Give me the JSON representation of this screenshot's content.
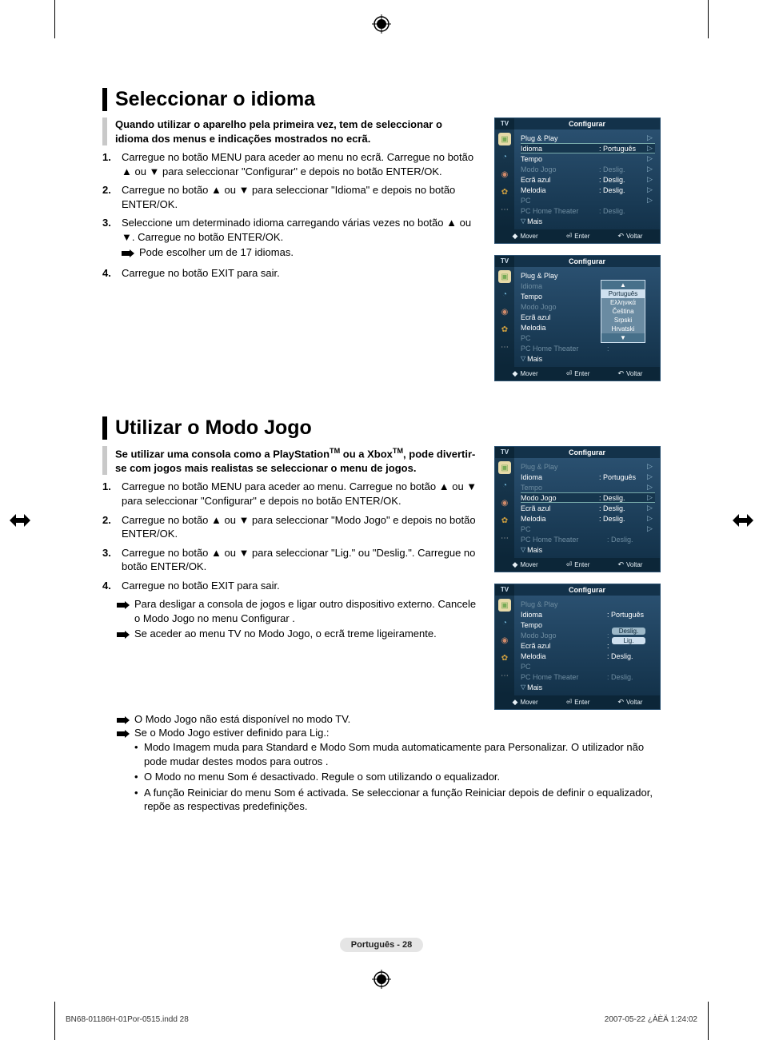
{
  "section1": {
    "title": "Seleccionar o idioma",
    "intro": "Quando utilizar o aparelho pela primeira vez, tem de seleccionar o idioma dos menus e indicações mostrados no ecrã.",
    "steps": [
      {
        "n": "1.",
        "t": "Carregue no botão MENU para aceder ao menu no ecrã. Carregue no botão ▲ ou ▼ para seleccionar \"Configurar\" e depois no botão ENTER/OK."
      },
      {
        "n": "2.",
        "t": "Carregue no botão ▲ ou ▼ para seleccionar \"Idioma\" e depois no botão ENTER/OK."
      },
      {
        "n": "3.",
        "t": "Seleccione um determinado idioma carregando várias vezes no botão ▲ ou ▼. Carregue no botão ENTER/OK."
      },
      {
        "n": "4.",
        "t": "Carregue no botão EXIT para sair."
      }
    ],
    "note_after3": "Pode escolher um de 17 idiomas."
  },
  "section2": {
    "title": "Utilizar o Modo Jogo",
    "intro_pre": "Se utilizar uma consola como a PlayStation",
    "intro_mid": " ou a Xbox",
    "intro_post": ", pode divertir-se com jogos mais realistas se seleccionar o menu de jogos.",
    "tm": "TM",
    "steps": [
      {
        "n": "1.",
        "t": "Carregue no botão MENU para aceder ao menu. Carregue no botão ▲ ou ▼ para seleccionar \"Configurar\" e depois no botão ENTER/OK."
      },
      {
        "n": "2.",
        "t": "Carregue no botão ▲ ou ▼ para seleccionar \"Modo Jogo\" e depois no botão ENTER/OK."
      },
      {
        "n": "3.",
        "t": "Carregue no botão ▲ ou ▼ para seleccionar \"Lig.\" ou \"Deslig.\". Carregue no botão ENTER/OK."
      },
      {
        "n": "4.",
        "t": "Carregue no botão EXIT para sair."
      }
    ],
    "notes": [
      "Para desligar a consola de jogos e ligar outro dispositivo externo. Cancele o Modo Jogo no menu Configurar .",
      "Se aceder ao menu TV no Modo Jogo, o ecrã treme ligeiramente.",
      "O Modo Jogo não está disponível no modo TV.",
      "Se o Modo Jogo estiver definido para Lig.:"
    ],
    "bullets": [
      "Modo Imagem muda para Standard e Modo Som muda automaticamente para Personalizar. O utilizador não pode mudar destes modos para outros .",
      "O Modo no menu Som é desactivado. Regule o som utilizando o equalizador.",
      "A função Reiniciar do menu Som é activada. Se seleccionar a função Reiniciar depois de definir o equalizador, repõe as respectivas predefinições."
    ]
  },
  "osd": {
    "tv": "TV",
    "title": "Configurar",
    "items": {
      "plugplay": "Plug & Play",
      "idioma": "Idioma",
      "tempo": "Tempo",
      "modojogo": "Modo Jogo",
      "ecra": "Ecrã azul",
      "melodia": "Melodia",
      "pc": "PC",
      "pcht": "PC Home Theater",
      "mais": "Mais"
    },
    "vals": {
      "portugues": "Português",
      "deslig": "Deslig.",
      "lig": "Lig."
    },
    "dropdown_langs": [
      "Português",
      "Ελληνικά",
      "Čeština",
      "Srpski",
      "Hrvatski"
    ],
    "col_prefix": ": ",
    "col_only": ":",
    "footer": {
      "mover": "Mover",
      "enter": "Enter",
      "voltar": "Voltar"
    }
  },
  "page_badge": "Português - 28",
  "meta": {
    "left": "BN68-01186H-01Por-0515.indd   28",
    "right": "2007-05-22   ¿ÀÈÄ 1:24:02"
  }
}
